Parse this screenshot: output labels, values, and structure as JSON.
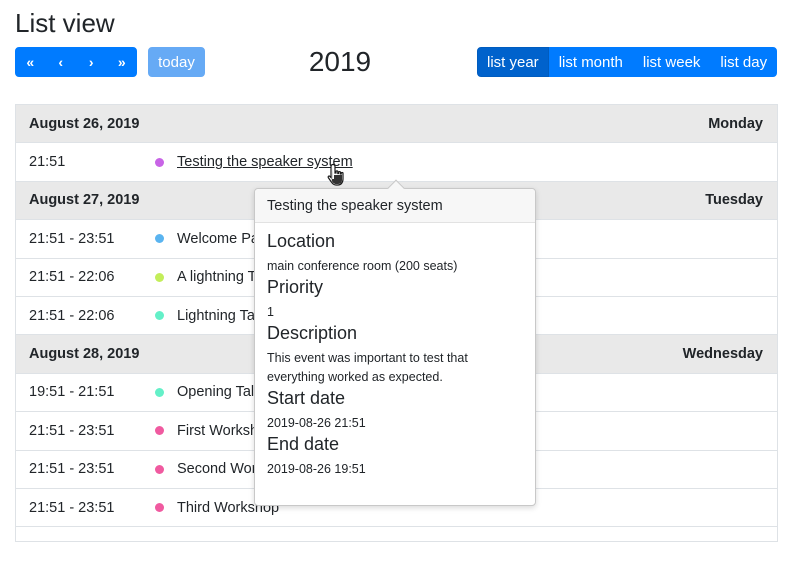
{
  "page": {
    "title": "List view"
  },
  "toolbar": {
    "nav": [
      {
        "name": "prev-year-button",
        "icon": "double-chevron-left-icon",
        "glyph": "«"
      },
      {
        "name": "prev-button",
        "icon": "chevron-left-icon",
        "glyph": "‹"
      },
      {
        "name": "next-button",
        "icon": "chevron-right-icon",
        "glyph": "›"
      },
      {
        "name": "next-year-button",
        "icon": "double-chevron-right-icon",
        "glyph": "»"
      }
    ],
    "today_label": "today",
    "title": "2019",
    "views": [
      {
        "label": "list year",
        "active": true
      },
      {
        "label": "list month",
        "active": false
      },
      {
        "label": "list week",
        "active": false
      },
      {
        "label": "list day",
        "active": false
      }
    ]
  },
  "colors": {
    "primary": "#007bff",
    "primary_active": "#0062cc",
    "today_disabled": "#66aaf5",
    "day_header_bg": "#e9e9e9"
  },
  "rows": [
    {
      "type": "day",
      "date": "August 26, 2019",
      "weekday": "Monday"
    },
    {
      "type": "event",
      "time": "21:51",
      "title": "Testing the speaker system",
      "color": "#c864e6",
      "hovered": true
    },
    {
      "type": "day",
      "date": "August 27, 2019",
      "weekday": "Tuesday"
    },
    {
      "type": "event",
      "time": "21:51 - 23:51",
      "title": "Welcome Part",
      "color": "#5ab4f0"
    },
    {
      "type": "event",
      "time": "21:51 - 22:06",
      "title": "A lightning Ta",
      "color": "#c3ee5a"
    },
    {
      "type": "event",
      "time": "21:51 - 22:06",
      "title": "Lightning Talk",
      "color": "#64f0c8"
    },
    {
      "type": "day",
      "date": "August 28, 2019",
      "weekday": "Wednesday"
    },
    {
      "type": "event",
      "time": "19:51 - 21:51",
      "title": "Opening Talk",
      "color": "#64f0c8"
    },
    {
      "type": "event",
      "time": "21:51 - 23:51",
      "title": "First Worksho",
      "color": "#f05aa0"
    },
    {
      "type": "event",
      "time": "21:51 - 23:51",
      "title": "Second Works",
      "color": "#f05aa0"
    },
    {
      "type": "event",
      "time": "21:51 - 23:51",
      "title": "Third Workshop",
      "color": "#f05aa0"
    }
  ],
  "popover": {
    "title": "Testing the speaker system",
    "fields": [
      {
        "label": "Location",
        "value": "main conference room (200 seats)"
      },
      {
        "label": "Priority",
        "value": "1"
      },
      {
        "label": "Description",
        "value": "This event was important to test that everything worked as expected."
      },
      {
        "label": "Start date",
        "value": "2019-08-26 21:51"
      },
      {
        "label": "End date",
        "value": "2019-08-26 19:51"
      }
    ]
  },
  "cursor": {
    "icon": "hand-pointer-icon"
  }
}
